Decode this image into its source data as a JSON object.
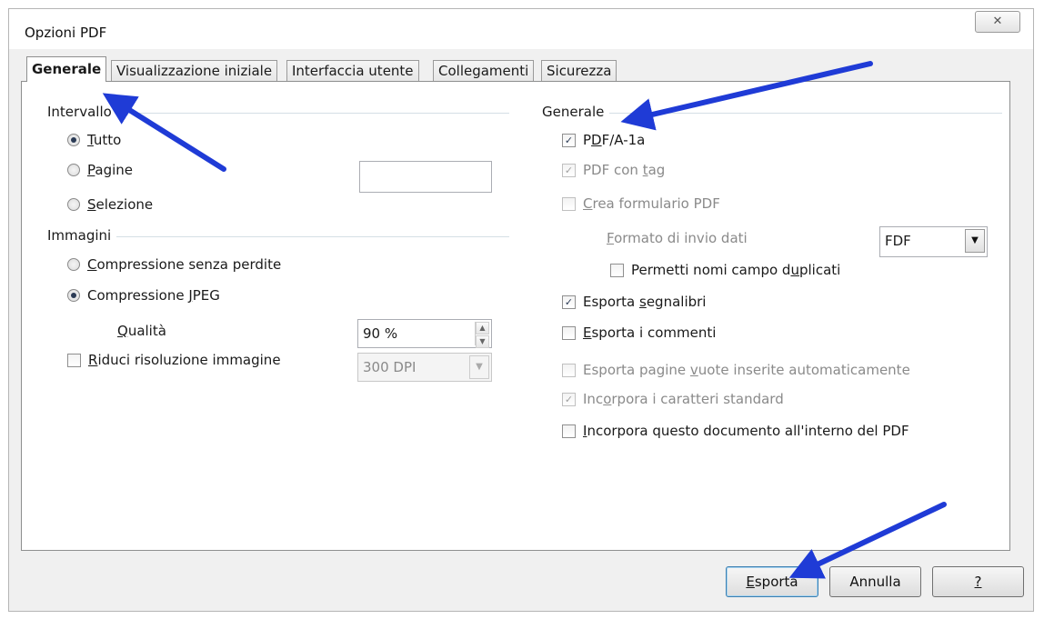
{
  "window": {
    "title": "Opzioni PDF",
    "close_icon": "close-icon"
  },
  "tabs": [
    "Generale",
    "Visualizzazione iniziale",
    "Interfaccia utente",
    "Collegamenti",
    "Sicurezza"
  ],
  "left": {
    "intervallo": {
      "label": "Intervallo",
      "tutto_u": "T",
      "tutto_rest": "utto",
      "pagine_u": "P",
      "pagine_rest": "agine",
      "selezione_u": "S",
      "selezione_rest": "elezione",
      "selected": "Tutto"
    },
    "immagini": {
      "label": "Immagini",
      "senza_perdite_u": "C",
      "senza_perdite_rest": "ompressione senza perdite",
      "jpeg_pre": "Compressione ",
      "jpeg_u": "J",
      "jpeg_rest": "PEG",
      "selected": "Compressione JPEG",
      "qualita_u": "Q",
      "qualita_rest": "ualità",
      "qualita_value": "90 %",
      "riduci_u": "R",
      "riduci_rest": "iduci risoluzione immagine",
      "riduci_checked": false,
      "dpi_value": "300 DPI"
    }
  },
  "right": {
    "label": "Generale",
    "pdfa_pre": "P",
    "pdfa_u": "D",
    "pdfa_rest": "F/A-1a",
    "pdfa_checked": true,
    "pdftag_pre": "PDF con ",
    "pdftag_u": "t",
    "pdftag_rest": "ag",
    "pdftag_checked": true,
    "formulario_u": "C",
    "formulario_rest": "rea formulario PDF",
    "formulario_checked": false,
    "formato_u": "F",
    "formato_rest": "ormato di invio dati",
    "formato_value": "FDF",
    "duplicati_pre": "Permetti nomi campo d",
    "duplicati_u": "u",
    "duplicati_rest": "plicati",
    "duplicati_checked": false,
    "segnalibri_pre": "Esporta ",
    "segnalibri_u": "s",
    "segnalibri_rest": "egnalibri",
    "segnalibri_checked": true,
    "commenti_u": "E",
    "commenti_rest": "sporta i commenti",
    "commenti_checked": false,
    "vuote_pre": "Esporta pagine ",
    "vuote_u": "v",
    "vuote_rest": "uote inserite automaticamente",
    "vuote_checked": false,
    "caratteri_pre": "Inc",
    "caratteri_u": "o",
    "caratteri_rest": "rpora i caratteri standard",
    "caratteri_checked": true,
    "incorpora_u": "I",
    "incorpora_rest": "ncorpora questo documento all'interno del PDF",
    "incorpora_checked": false
  },
  "buttons": {
    "esporta_u": "E",
    "esporta_rest": "sporta",
    "annulla": "Annulla",
    "help": "?"
  },
  "colors": {
    "arrow": "#1f3bd6",
    "panel_border": "#8e8f8f",
    "window_bg": "#f0f0f0"
  }
}
